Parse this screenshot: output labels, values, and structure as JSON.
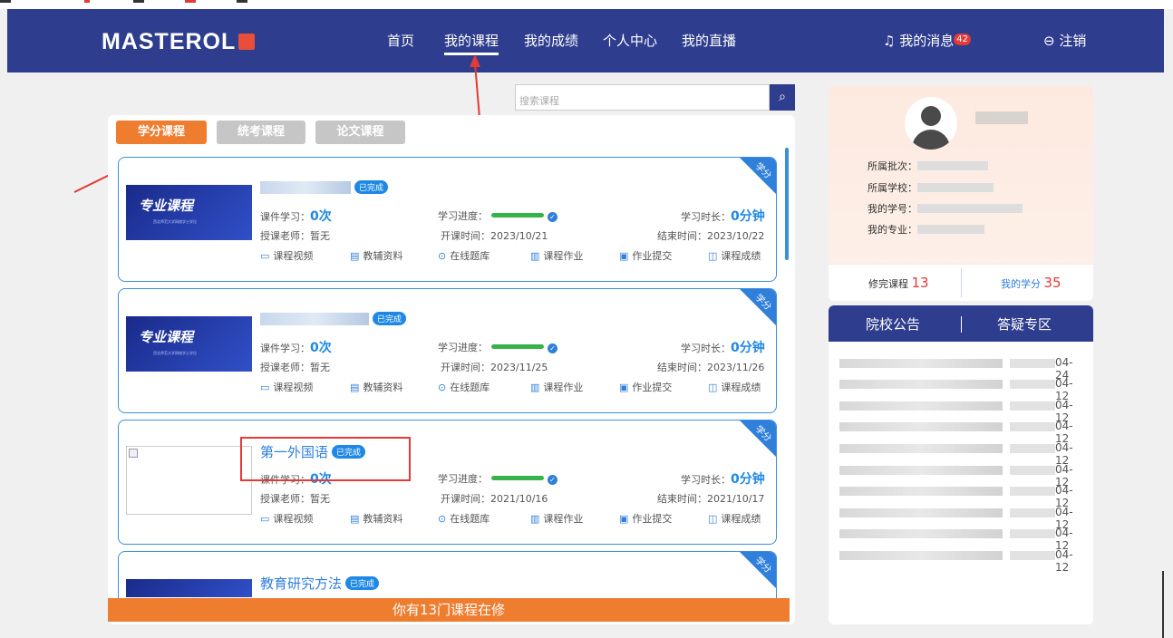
{
  "header": {
    "logo": "MASTEROL",
    "nav": [
      {
        "label": "首页"
      },
      {
        "label": "我的课程"
      },
      {
        "label": "我的成绩"
      },
      {
        "label": "个人中心"
      },
      {
        "label": "我的直播"
      }
    ],
    "messages_label": "我的消息",
    "messages_count": "42",
    "logout_label": "注销"
  },
  "search": {
    "placeholder": "搜索课程"
  },
  "tabs": [
    {
      "label": "学分课程"
    },
    {
      "label": "统考课程"
    },
    {
      "label": "论文课程"
    }
  ],
  "labels": {
    "credit_corner": "学分",
    "completed": "已完成",
    "study_count": "课件学习：",
    "progress": "学习进度：",
    "duration": "学习时长：",
    "teacher": "授课老师：",
    "start": "开课时间：",
    "end": "结束时间：",
    "thumb_title": "专业课程",
    "thumb_sub": "西北师范大学网络学士学位",
    "links": [
      "课程视频",
      "教辅资料",
      "在线题库",
      "课程作业",
      "作业提交",
      "课程成绩"
    ]
  },
  "courses": [
    {
      "title": "",
      "count": "0次",
      "duration": "0分钟",
      "teacher": "暂无",
      "start": "2023/10/21",
      "end": "2023/10/22"
    },
    {
      "title": "",
      "count": "0次",
      "duration": "0分钟",
      "teacher": "暂无",
      "start": "2023/11/25",
      "end": "2023/11/26"
    },
    {
      "title": "第一外国语",
      "count": "0次",
      "duration": "0分钟",
      "teacher": "暂无",
      "start": "2021/10/16",
      "end": "2021/10/17"
    },
    {
      "title": "教育研究方法"
    }
  ],
  "footer_text": "你有13门课程在修",
  "profile": {
    "batch_label": "所属批次：",
    "school_label": "所属学校：",
    "student_id_label": "我的学号：",
    "major_label": "我的专业：",
    "finished_label": "修完课程",
    "finished_value": "13",
    "credits_label": "我的学分",
    "credits_value": "35"
  },
  "notice": {
    "tab_announcements": "院校公告",
    "tab_qa": "答疑专区",
    "dates": [
      "04-24",
      "04-12",
      "04-12",
      "04-12",
      "04-12",
      "04-12",
      "04-12",
      "04-12",
      "04-12",
      "04-12"
    ]
  },
  "colors": {
    "navbar": "#2e3d8e",
    "accent_orange": "#ee7d30",
    "accent_blue": "#2f7fdb",
    "highlight_red": "#e53935",
    "progress_green": "#35b34a"
  }
}
